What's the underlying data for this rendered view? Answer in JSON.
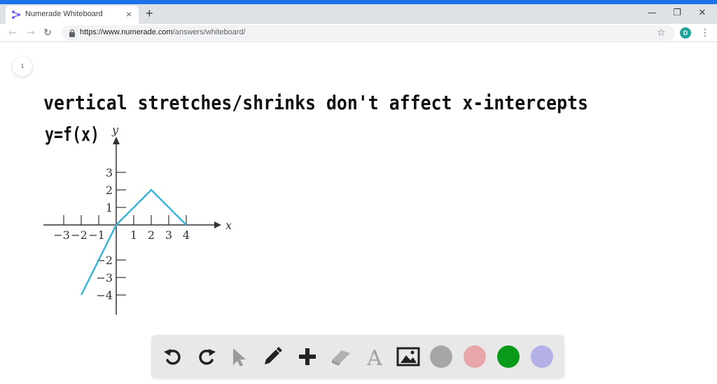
{
  "browser": {
    "tab_title": "Numerade Whiteboard",
    "close_glyph": "×",
    "new_tab_glyph": "+",
    "url_prefix": "https://www.",
    "url_host": "numerade.com",
    "url_path": "/answers/whiteboard/",
    "profile_initial": "D",
    "colors": {
      "accent": "#1a73e8",
      "avatar": "#1aa39a"
    }
  },
  "whiteboard": {
    "page_number": "1",
    "handwriting_line1": "vertical stretches/shrinks don't affect x-intercepts",
    "handwriting_line2": "y=f(x)"
  },
  "chart_data": {
    "type": "line",
    "xlabel": "x",
    "ylabel": "y",
    "x_tick_labels": [
      "−3",
      "−2",
      "−1",
      "1",
      "2",
      "3",
      "4"
    ],
    "y_tick_labels": [
      "3",
      "2",
      "1",
      "−2",
      "−3",
      "−4"
    ],
    "xlim": [
      -4,
      6
    ],
    "ylim": [
      -5,
      5
    ],
    "series": [
      {
        "x": [
          -2,
          0,
          2,
          4
        ],
        "y": [
          -4,
          0,
          2,
          0
        ],
        "color": "#3cb4d8"
      }
    ]
  },
  "tools": [
    {
      "name": "undo-icon",
      "label": "undo"
    },
    {
      "name": "redo-icon",
      "label": "redo"
    },
    {
      "name": "pointer-icon",
      "label": "select"
    },
    {
      "name": "pencil-icon",
      "label": "draw"
    },
    {
      "name": "plus-icon",
      "label": "add"
    },
    {
      "name": "eraser-icon",
      "label": "erase"
    },
    {
      "name": "text-icon",
      "label": "text"
    },
    {
      "name": "image-icon",
      "label": "image"
    }
  ],
  "swatches": [
    "#a6a6a6",
    "#e8a6aa",
    "#0a9a1a",
    "#b4b0e8"
  ]
}
